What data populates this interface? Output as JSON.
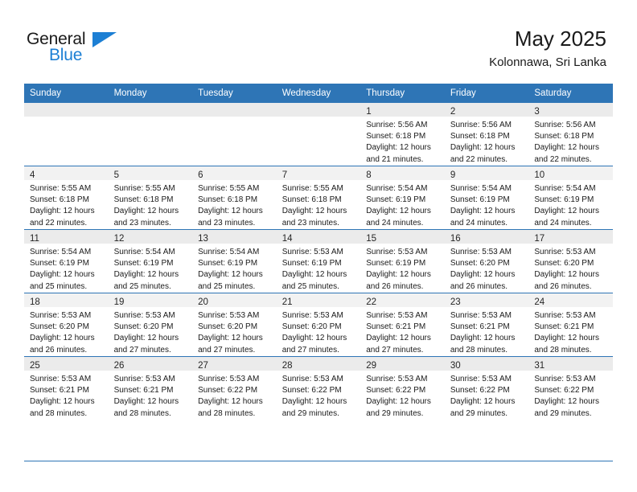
{
  "brand": {
    "name_top": "General",
    "name_bottom": "Blue",
    "triangle_color": "#1c7fd4"
  },
  "header": {
    "title": "May 2025",
    "subtitle": "Kolonnawa, Sri Lanka"
  },
  "theme": {
    "header_blue": "#2e75b6",
    "daynum_strip": "#f2f2f2",
    "text": "#1a1a1a"
  },
  "calendar": {
    "weekday_headers": [
      "Sunday",
      "Monday",
      "Tuesday",
      "Wednesday",
      "Thursday",
      "Friday",
      "Saturday"
    ],
    "weeks": [
      [
        {
          "day": "",
          "lines": []
        },
        {
          "day": "",
          "lines": []
        },
        {
          "day": "",
          "lines": []
        },
        {
          "day": "",
          "lines": []
        },
        {
          "day": "1",
          "lines": [
            "Sunrise: 5:56 AM",
            "Sunset: 6:18 PM",
            "Daylight: 12 hours",
            "and 21 minutes."
          ]
        },
        {
          "day": "2",
          "lines": [
            "Sunrise: 5:56 AM",
            "Sunset: 6:18 PM",
            "Daylight: 12 hours",
            "and 22 minutes."
          ]
        },
        {
          "day": "3",
          "lines": [
            "Sunrise: 5:56 AM",
            "Sunset: 6:18 PM",
            "Daylight: 12 hours",
            "and 22 minutes."
          ]
        }
      ],
      [
        {
          "day": "4",
          "lines": [
            "Sunrise: 5:55 AM",
            "Sunset: 6:18 PM",
            "Daylight: 12 hours",
            "and 22 minutes."
          ]
        },
        {
          "day": "5",
          "lines": [
            "Sunrise: 5:55 AM",
            "Sunset: 6:18 PM",
            "Daylight: 12 hours",
            "and 23 minutes."
          ]
        },
        {
          "day": "6",
          "lines": [
            "Sunrise: 5:55 AM",
            "Sunset: 6:18 PM",
            "Daylight: 12 hours",
            "and 23 minutes."
          ]
        },
        {
          "day": "7",
          "lines": [
            "Sunrise: 5:55 AM",
            "Sunset: 6:18 PM",
            "Daylight: 12 hours",
            "and 23 minutes."
          ]
        },
        {
          "day": "8",
          "lines": [
            "Sunrise: 5:54 AM",
            "Sunset: 6:19 PM",
            "Daylight: 12 hours",
            "and 24 minutes."
          ]
        },
        {
          "day": "9",
          "lines": [
            "Sunrise: 5:54 AM",
            "Sunset: 6:19 PM",
            "Daylight: 12 hours",
            "and 24 minutes."
          ]
        },
        {
          "day": "10",
          "lines": [
            "Sunrise: 5:54 AM",
            "Sunset: 6:19 PM",
            "Daylight: 12 hours",
            "and 24 minutes."
          ]
        }
      ],
      [
        {
          "day": "11",
          "lines": [
            "Sunrise: 5:54 AM",
            "Sunset: 6:19 PM",
            "Daylight: 12 hours",
            "and 25 minutes."
          ]
        },
        {
          "day": "12",
          "lines": [
            "Sunrise: 5:54 AM",
            "Sunset: 6:19 PM",
            "Daylight: 12 hours",
            "and 25 minutes."
          ]
        },
        {
          "day": "13",
          "lines": [
            "Sunrise: 5:54 AM",
            "Sunset: 6:19 PM",
            "Daylight: 12 hours",
            "and 25 minutes."
          ]
        },
        {
          "day": "14",
          "lines": [
            "Sunrise: 5:53 AM",
            "Sunset: 6:19 PM",
            "Daylight: 12 hours",
            "and 25 minutes."
          ]
        },
        {
          "day": "15",
          "lines": [
            "Sunrise: 5:53 AM",
            "Sunset: 6:19 PM",
            "Daylight: 12 hours",
            "and 26 minutes."
          ]
        },
        {
          "day": "16",
          "lines": [
            "Sunrise: 5:53 AM",
            "Sunset: 6:20 PM",
            "Daylight: 12 hours",
            "and 26 minutes."
          ]
        },
        {
          "day": "17",
          "lines": [
            "Sunrise: 5:53 AM",
            "Sunset: 6:20 PM",
            "Daylight: 12 hours",
            "and 26 minutes."
          ]
        }
      ],
      [
        {
          "day": "18",
          "lines": [
            "Sunrise: 5:53 AM",
            "Sunset: 6:20 PM",
            "Daylight: 12 hours",
            "and 26 minutes."
          ]
        },
        {
          "day": "19",
          "lines": [
            "Sunrise: 5:53 AM",
            "Sunset: 6:20 PM",
            "Daylight: 12 hours",
            "and 27 minutes."
          ]
        },
        {
          "day": "20",
          "lines": [
            "Sunrise: 5:53 AM",
            "Sunset: 6:20 PM",
            "Daylight: 12 hours",
            "and 27 minutes."
          ]
        },
        {
          "day": "21",
          "lines": [
            "Sunrise: 5:53 AM",
            "Sunset: 6:20 PM",
            "Daylight: 12 hours",
            "and 27 minutes."
          ]
        },
        {
          "day": "22",
          "lines": [
            "Sunrise: 5:53 AM",
            "Sunset: 6:21 PM",
            "Daylight: 12 hours",
            "and 27 minutes."
          ]
        },
        {
          "day": "23",
          "lines": [
            "Sunrise: 5:53 AM",
            "Sunset: 6:21 PM",
            "Daylight: 12 hours",
            "and 28 minutes."
          ]
        },
        {
          "day": "24",
          "lines": [
            "Sunrise: 5:53 AM",
            "Sunset: 6:21 PM",
            "Daylight: 12 hours",
            "and 28 minutes."
          ]
        }
      ],
      [
        {
          "day": "25",
          "lines": [
            "Sunrise: 5:53 AM",
            "Sunset: 6:21 PM",
            "Daylight: 12 hours",
            "and 28 minutes."
          ]
        },
        {
          "day": "26",
          "lines": [
            "Sunrise: 5:53 AM",
            "Sunset: 6:21 PM",
            "Daylight: 12 hours",
            "and 28 minutes."
          ]
        },
        {
          "day": "27",
          "lines": [
            "Sunrise: 5:53 AM",
            "Sunset: 6:22 PM",
            "Daylight: 12 hours",
            "and 28 minutes."
          ]
        },
        {
          "day": "28",
          "lines": [
            "Sunrise: 5:53 AM",
            "Sunset: 6:22 PM",
            "Daylight: 12 hours",
            "and 29 minutes."
          ]
        },
        {
          "day": "29",
          "lines": [
            "Sunrise: 5:53 AM",
            "Sunset: 6:22 PM",
            "Daylight: 12 hours",
            "and 29 minutes."
          ]
        },
        {
          "day": "30",
          "lines": [
            "Sunrise: 5:53 AM",
            "Sunset: 6:22 PM",
            "Daylight: 12 hours",
            "and 29 minutes."
          ]
        },
        {
          "day": "31",
          "lines": [
            "Sunrise: 5:53 AM",
            "Sunset: 6:22 PM",
            "Daylight: 12 hours",
            "and 29 minutes."
          ]
        }
      ]
    ]
  }
}
